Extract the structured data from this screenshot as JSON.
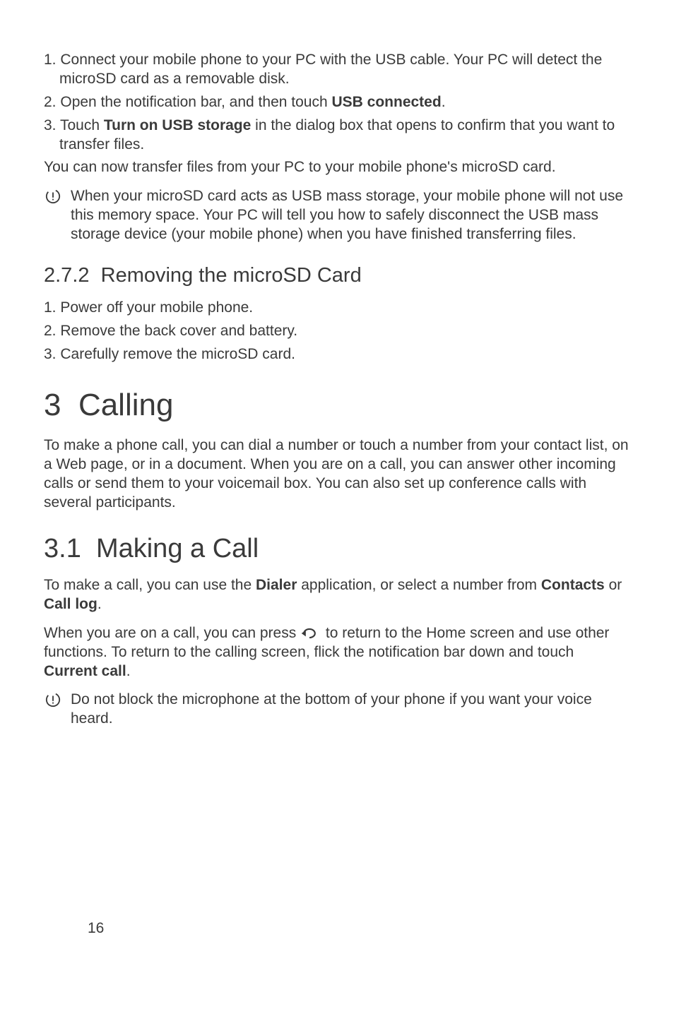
{
  "step_a": {
    "n1": "1.",
    "t1a": "Connect your mobile phone to your PC with the USB cable. Your PC will detect the microSD card as a removable disk.",
    "n2": "2.",
    "t2a": "Open the notification bar, and then touch ",
    "t2b": "USB connected",
    "t2c": ".",
    "n3": "3.",
    "t3a": "Touch ",
    "t3b": "Turn on USB storage",
    "t3c": " in the dialog box that opens to confirm that you want to transfer files."
  },
  "para1": "You can now transfer files from your PC to your mobile phone's microSD card.",
  "note1": "When your microSD card acts as USB mass storage, your mobile phone will not use this memory space. Your PC will tell you how to safely disconnect the USB mass storage device (your mobile phone) when you have finished transferring files.",
  "h3a_num": "2.7.2",
  "h3a_title": "Removing the microSD Card",
  "step_b": {
    "n1": "1.",
    "t1": "Power off your mobile phone.",
    "n2": "2.",
    "t2": "Remove the back cover and battery.",
    "n3": "3.",
    "t3": "Carefully remove the microSD card."
  },
  "h1_num": "3",
  "h1_title": "Calling",
  "para2": "To make a phone call, you can dial a number or touch a number from your contact list, on a Web page, or in a document. When you are on a call, you can answer other incoming calls or send them to your voicemail box. You can also set up conference calls with several participants.",
  "h2_num": "3.1",
  "h2_title": "Making a Call",
  "para3": {
    "a": "To make a call, you can use the ",
    "b": "Dialer",
    "c": " application, or select a number from  ",
    "d": "Contacts",
    "e": " or ",
    "f": "Call log",
    "g": "."
  },
  "para4": {
    "a": "When you are on a call, you can press ",
    "b": " to return to the Home screen and use other functions. To return to the calling screen, flick the notification bar down and touch ",
    "c": "Current call",
    "d": "."
  },
  "note2": "Do not block the microphone at the bottom of your phone if you want your voice heard.",
  "page_number": "16"
}
